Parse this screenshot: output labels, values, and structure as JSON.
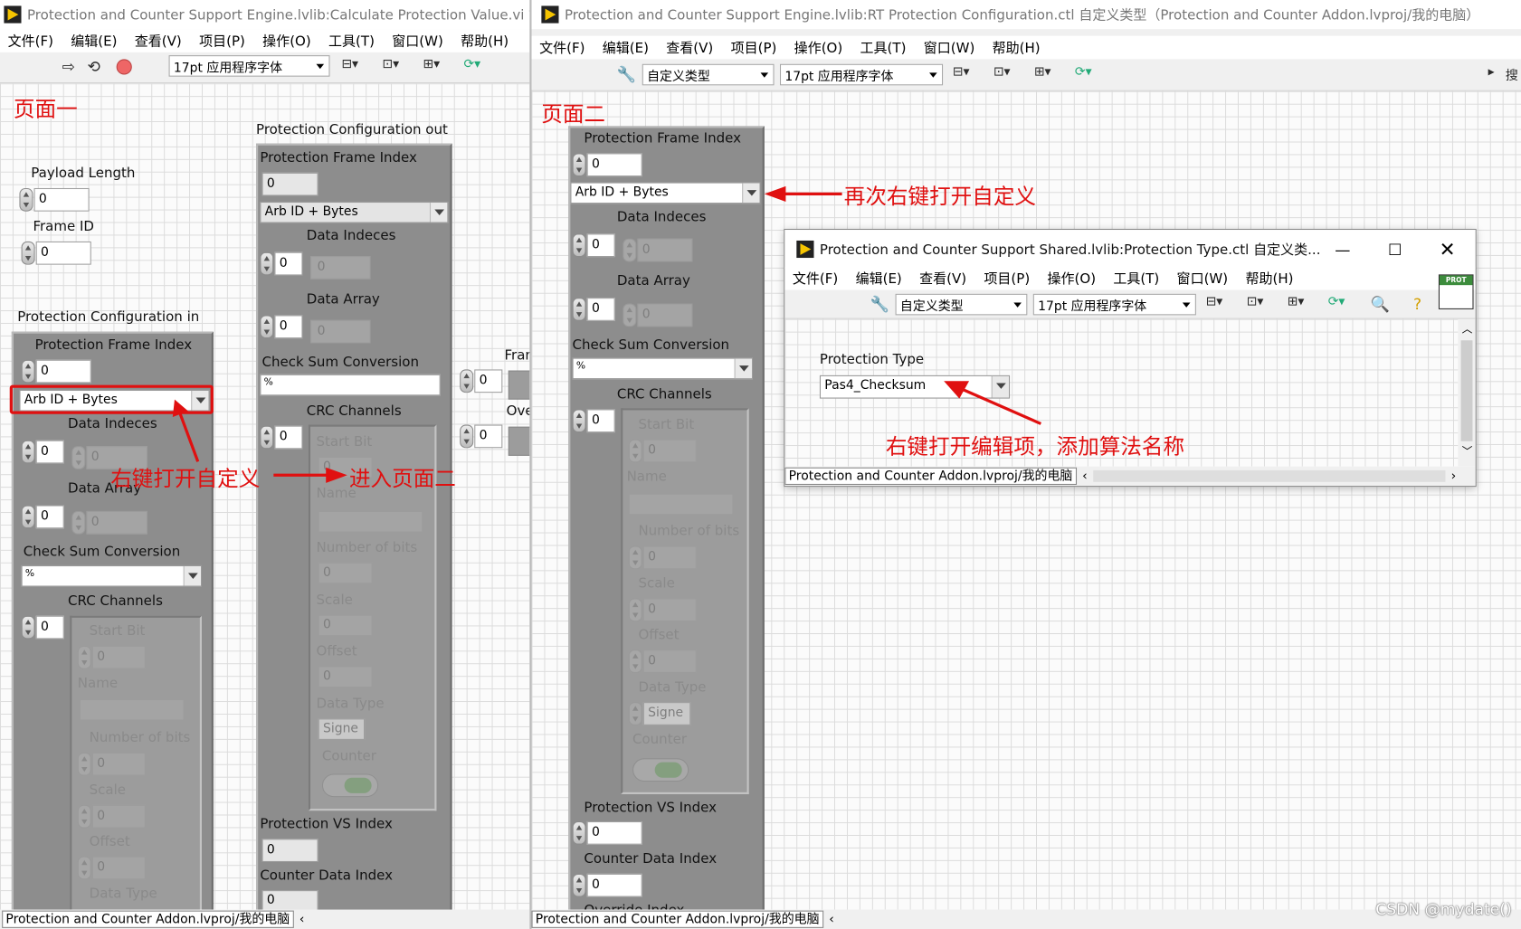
{
  "win1": {
    "title": "Protection and Counter Support Engine.lvlib:Calculate Protection Value.vi 前面",
    "menu": [
      "文件(F)",
      "编辑(E)",
      "查看(V)",
      "项目(P)",
      "操作(O)",
      "工具(T)",
      "窗口(W)",
      "帮助(H)"
    ],
    "font_select": "17pt 应用程序字体",
    "page_label": "页面一",
    "payload_length": {
      "label": "Payload Length",
      "value": "0"
    },
    "frame_id": {
      "label": "Frame ID",
      "value": "0"
    },
    "config_in": {
      "title": "Protection Configuration in",
      "frame_index": {
        "label": "Protection Frame Index",
        "value": "0"
      },
      "type_ring": "Arb ID + Bytes",
      "data_indeces": {
        "label": "Data Indeces",
        "value": "0",
        "elem": "0"
      },
      "data_array": {
        "label": "Data Array",
        "value": "0",
        "elem": "0"
      },
      "checksum": {
        "label": "Check Sum Conversion",
        "value": ""
      },
      "crc": {
        "label": "CRC Channels",
        "value": "0",
        "start_bit": {
          "label": "Start Bit",
          "value": "0"
        },
        "name": {
          "label": "Name"
        },
        "num_bits": {
          "label": "Number of bits",
          "value": "0"
        },
        "scale": {
          "label": "Scale",
          "value": "0"
        },
        "offset": {
          "label": "Offset",
          "value": "0"
        },
        "data_type": {
          "label": "Data Type"
        }
      }
    },
    "config_out": {
      "title": "Protection Configuration out",
      "frame_index": {
        "label": "Protection Frame Index",
        "value": "0"
      },
      "type_ring": "Arb ID + Bytes",
      "data_indeces": {
        "label": "Data Indeces",
        "value": "0",
        "elem": "0"
      },
      "data_array": {
        "label": "Data Array",
        "value": "0",
        "elem": "0"
      },
      "checksum": {
        "label": "Check Sum Conversion",
        "value": ""
      },
      "crc": {
        "label": "CRC Channels",
        "value": "0",
        "start_bit": {
          "label": "Start Bit",
          "value": "0"
        },
        "name": {
          "label": "Name"
        },
        "num_bits": {
          "label": "Number of bits",
          "value": "0"
        },
        "scale": {
          "label": "Scale",
          "value": "0"
        },
        "offset": {
          "label": "Offset",
          "value": "0"
        },
        "data_type": {
          "label": "Data Type",
          "value": "Signe"
        },
        "counter": {
          "label": "Counter"
        }
      },
      "vs_index": {
        "label": "Protection VS Index",
        "value": "0"
      },
      "counter_index": {
        "label": "Counter Data Index",
        "value": "0"
      }
    },
    "partial": {
      "fran": "Fran",
      "ove": "Ove",
      "v1": "0",
      "v2": "0"
    },
    "annotation_rightclick": "右键打开自定义",
    "annotation_enter": "进入页面二",
    "status_path": "Protection and Counter Addon.lvproj/我的电脑"
  },
  "win2": {
    "title": "Protection and Counter Support Engine.lvlib:RT Protection Configuration.ctl 自定义类型（Protection and Counter Addon.lvproj/我的电脑）",
    "menu": [
      "文件(F)",
      "编辑(E)",
      "查看(V)",
      "项目(P)",
      "操作(O)",
      "工具(T)",
      "窗口(W)",
      "帮助(H)"
    ],
    "type_select": "自定义类型",
    "font_select": "17pt 应用程序字体",
    "search_hint": "搜",
    "page_label": "页面二",
    "frame_index": {
      "label": "Protection Frame Index",
      "value": "0"
    },
    "type_ring": "Arb ID + Bytes",
    "annotation": "再次右键打开自定义",
    "data_indeces": {
      "label": "Data Indeces",
      "value": "0",
      "elem": "0"
    },
    "data_array": {
      "label": "Data Array",
      "value": "0",
      "elem": "0"
    },
    "checksum": {
      "label": "Check Sum Conversion",
      "value": ""
    },
    "crc": {
      "label": "CRC Channels",
      "value": "0",
      "start_bit": {
        "label": "Start Bit",
        "value": "0"
      },
      "name": {
        "label": "Name"
      },
      "num_bits": {
        "label": "Number of bits",
        "value": "0"
      },
      "scale": {
        "label": "Scale",
        "value": "0"
      },
      "offset": {
        "label": "Offset",
        "value": "0"
      },
      "data_type": {
        "label": "Data Type",
        "value": "Signe"
      },
      "counter": {
        "label": "Counter"
      }
    },
    "vs_index": {
      "label": "Protection VS Index",
      "value": "0"
    },
    "counter_index": {
      "label": "Counter Data Index",
      "value": "0"
    },
    "override": {
      "label": "Override Index"
    },
    "status_path": "Protection and Counter Addon.lvproj/我的电脑"
  },
  "win3": {
    "title": "Protection and Counter Support Shared.lvlib:Protection Type.ctl 自定义类...",
    "menu": [
      "文件(F)",
      "编辑(E)",
      "查看(V)",
      "项目(P)",
      "操作(O)",
      "工具(T)",
      "窗口(W)",
      "帮助(H)"
    ],
    "type_select": "自定义类型",
    "font_select": "17pt 应用程序字体",
    "lib_badge": "PROT LIB",
    "protection_type": {
      "label": "Protection Type",
      "value": "Pas4_Checksum"
    },
    "annotation": "右键打开编辑项，添加算法名称",
    "status_path": "Protection and Counter Addon.lvproj/我的电脑"
  },
  "watermark": "CSDN @mydate()",
  "colors": {
    "accent_red": "#e01010",
    "cluster_gray": "#8d8d8d",
    "grid": "#dcdcdc"
  }
}
